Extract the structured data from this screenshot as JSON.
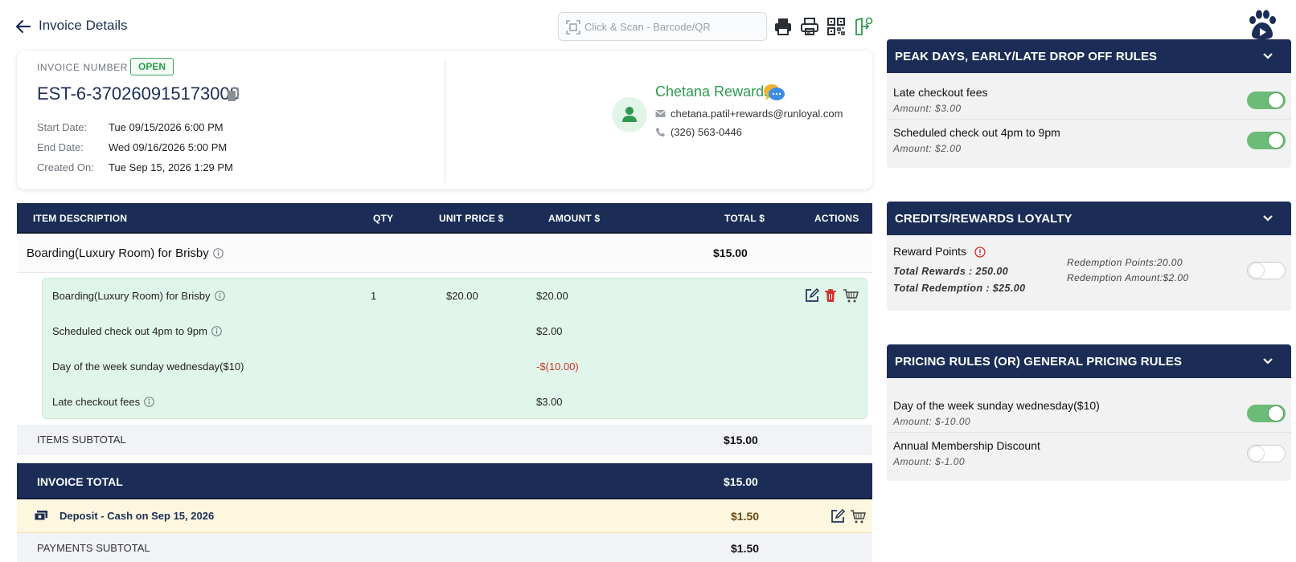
{
  "header": {
    "title": "Invoice Details",
    "scan_placeholder": "Click & Scan - Barcode/QR"
  },
  "invoice": {
    "number_label": "INVOICE NUMBER",
    "status": "OPEN",
    "number": "EST-6-370260915173000",
    "start_label": "Start Date:",
    "start_value": "Tue 09/15/2026 6:00 PM",
    "end_label": "End Date:",
    "end_value": "Wed 09/16/2026 5:00 PM",
    "created_label": "Created On:",
    "created_value": "Tue Sep 15, 2026 1:29 PM"
  },
  "customer": {
    "name": "Chetana Rewards",
    "email": "chetana.patil+rewards@runloyal.com",
    "phone": "(326) 563-0446"
  },
  "table": {
    "headers": {
      "description": "ITEM DESCRIPTION",
      "qty": "QTY",
      "unit_price": "UNIT PRICE $",
      "amount": "AMOUNT $",
      "total": "TOTAL $",
      "actions": "ACTIONS"
    },
    "parent": {
      "description": "Boarding(Luxury Room) for Brisby",
      "total": "$15.00"
    },
    "lines": [
      {
        "description": "Boarding(Luxury Room) for Brisby",
        "qty": "1",
        "unit_price": "$20.00",
        "amount": "$20.00"
      },
      {
        "description": "Scheduled check out 4pm to 9pm",
        "amount": "$2.00"
      },
      {
        "description": "Day of the week sunday wednesday($10)",
        "amount": "-$(10.00)"
      },
      {
        "description": "Late checkout fees",
        "amount": "$3.00"
      }
    ],
    "items_subtotal_label": "ITEMS SUBTOTAL",
    "items_subtotal": "$15.00",
    "invoice_total_label": "INVOICE TOTAL",
    "invoice_total": "$15.00",
    "deposit_label": "Deposit - Cash on Sep 15, 2026",
    "deposit_amount": "$1.50",
    "payments_subtotal_label": "PAYMENTS SUBTOTAL",
    "payments_subtotal": "$1.50"
  },
  "panels": {
    "peak": {
      "title": "PEAK DAYS, EARLY/LATE DROP OFF RULES",
      "rules": [
        {
          "name": "Late checkout fees",
          "amount": "Amount: $3.00",
          "enabled": true
        },
        {
          "name": "Scheduled check out 4pm to 9pm",
          "amount": "Amount: $2.00",
          "enabled": true
        }
      ]
    },
    "loyalty": {
      "title": "CREDITS/REWARDS LOYALTY",
      "reward_label": "Reward Points",
      "total_rewards": "Total Rewards : 250.00",
      "total_redemption": "Total Redemption : $25.00",
      "redemption_points": "Redemption Points:20.00",
      "redemption_amount": "Redemption Amount:$2.00",
      "enabled": false
    },
    "pricing": {
      "title": "PRICING RULES (OR) GENERAL PRICING RULES",
      "rules": [
        {
          "name": "Day of the week sunday wednesday($10)",
          "amount": "Amount: $-10.00",
          "enabled": true
        },
        {
          "name": "Annual Membership Discount",
          "amount": "Amount: $-1.00",
          "enabled": false
        }
      ]
    }
  },
  "colors": {
    "navy": "#1b2d56",
    "green": "#2f9a4d",
    "toggle_on": "#6cbb78",
    "line_bg": "#e1f6ea",
    "negative": "#d0302e",
    "deposit_bg": "#fdf7e0"
  },
  "icons": [
    "back-arrow-icon",
    "barcode-scan-icon",
    "print-icon",
    "receipt-print-icon",
    "qr-code-icon",
    "checkin-icon",
    "paw-icon",
    "copy-icon",
    "user-icon",
    "chat-icon",
    "email-icon",
    "phone-icon",
    "info-icon",
    "edit-icon",
    "trash-icon",
    "cart-icon",
    "cash-icon",
    "chevron-down-icon",
    "alert-icon"
  ]
}
